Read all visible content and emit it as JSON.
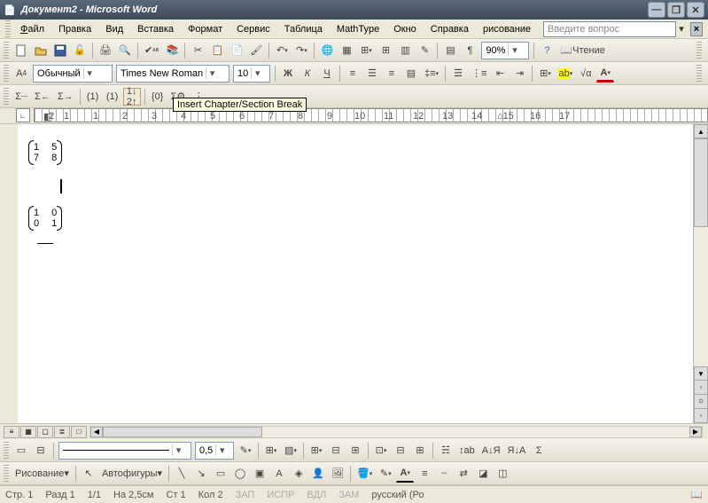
{
  "title": "Документ2 - Microsoft Word",
  "menu": {
    "file": "Файл",
    "edit": "Правка",
    "view": "Вид",
    "insert": "Вставка",
    "format": "Формат",
    "tools": "Сервис",
    "table": "Таблица",
    "mathtype": "MathType",
    "window": "Окно",
    "help": "Справка",
    "drawing": "рисование"
  },
  "askbox": {
    "placeholder": "Введите вопрос"
  },
  "formatting": {
    "style_label": "A4",
    "style": "Обычный",
    "font": "Times New Roman",
    "size": "10",
    "bold": "Ж",
    "italic": "К",
    "underline": "Ч"
  },
  "zoom": "90%",
  "reading_label": "Чтение",
  "tooltip": "Insert Chapter/Section Break",
  "ruler_numbers": [
    "1",
    "2",
    "1",
    "2",
    "3",
    "4",
    "5",
    "6",
    "7",
    "8",
    "9",
    "10",
    "11",
    "12",
    "13",
    "14",
    "15",
    "16",
    "17"
  ],
  "document": {
    "matrix1": [
      [
        "1",
        "5"
      ],
      [
        "7",
        "8"
      ]
    ],
    "matrix2": [
      [
        "1",
        "0"
      ],
      [
        "0",
        "1"
      ]
    ]
  },
  "line_toolbar": {
    "weight": "0,5"
  },
  "drawing_toolbar": {
    "draw_label": "Рисование",
    "autoshapes": "Автофигуры"
  },
  "status": {
    "page_label": "Стр.",
    "page": "1",
    "section_label": "Разд",
    "section": "1",
    "pages": "1/1",
    "at_label": "На",
    "at": "2,5см",
    "line_label": "Ст",
    "line": "1",
    "col_label": "Кол",
    "col": "2",
    "rec": "ЗАП",
    "trk": "ИСПР",
    "ext": "ВДЛ",
    "ovr": "ЗАМ",
    "lang": "русский (Ро"
  }
}
